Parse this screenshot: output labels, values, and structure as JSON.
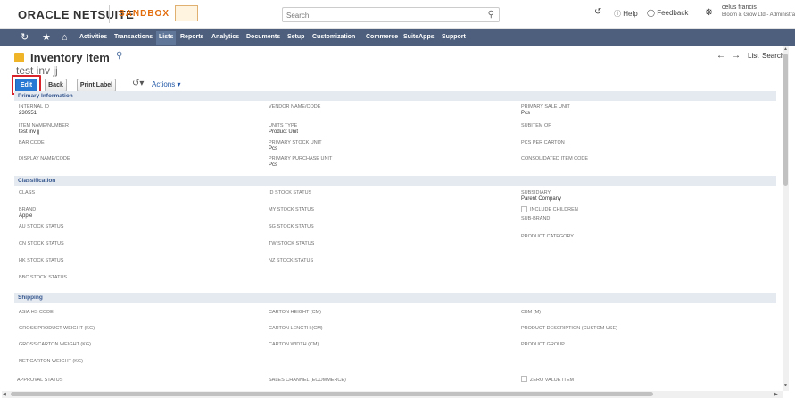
{
  "topbar": {
    "logo_main": "ORACLE NETSUITE",
    "environment": "SANDBOX",
    "search_placeholder": "Search",
    "help_label": "Help",
    "feedback_label": "Feedback",
    "user_name": "celus francis",
    "user_role": "Bloom & Grow Ltd - Administrator"
  },
  "navbar": {
    "items": [
      "Activities",
      "Transactions",
      "Lists",
      "Reports",
      "Analytics",
      "Documents",
      "Setup",
      "Customization",
      "Commerce",
      "SuiteApps",
      "Support"
    ],
    "active": "Lists"
  },
  "header": {
    "title": "Inventory Item",
    "record_name": "test inv jj",
    "list_link": "List",
    "search_link": "Search"
  },
  "buttons": {
    "edit": "Edit",
    "back": "Back",
    "print_label": "Print Label",
    "actions": "Actions"
  },
  "sections": {
    "primary": "Primary Information",
    "classification": "Classification",
    "shipping": "Shipping"
  },
  "primary_fields": {
    "internal_id_label": "INTERNAL ID",
    "internal_id_value": "230551",
    "item_name_label": "ITEM NAME/NUMBER",
    "item_name_value": "test inv jj",
    "bar_code_label": "BAR CODE",
    "display_name_label": "DISPLAY NAME/CODE",
    "vendor_name_label": "VENDOR NAME/CODE",
    "units_type_label": "UNITS TYPE",
    "units_type_value": "Product Unit",
    "primary_stock_unit_label": "PRIMARY STOCK UNIT",
    "primary_stock_unit_value": "Pcs",
    "primary_purchase_unit_label": "PRIMARY PURCHASE UNIT",
    "primary_purchase_unit_value": "Pcs",
    "primary_sale_unit_label": "PRIMARY SALE UNIT",
    "primary_sale_unit_value": "Pcs",
    "subitem_of_label": "SUBITEM OF",
    "pcs_per_carton_label": "PCS PER CARTON",
    "consolidated_item_code_label": "CONSOLIDATED ITEM CODE"
  },
  "classification_fields": {
    "class_label": "CLASS",
    "brand_label": "BRAND",
    "brand_value": "Apple",
    "au_stock_label": "AU STOCK STATUS",
    "cn_stock_label": "CN STOCK STATUS",
    "hk_stock_label": "HK STOCK STATUS",
    "bbc_stock_label": "BBC STOCK STATUS",
    "id_stock_label": "ID STOCK STATUS",
    "my_stock_label": "MY STOCK STATUS",
    "sg_stock_label": "SG STOCK STATUS",
    "tw_stock_label": "TW STOCK STATUS",
    "nz_stock_label": "NZ STOCK STATUS",
    "subsidiary_label": "SUBSIDIARY",
    "subsidiary_value": "Parent Company",
    "include_children_label": "INCLUDE CHILDREN",
    "sub_brand_label": "SUB-BRAND",
    "product_category_label": "PRODUCT CATEGORY"
  },
  "shipping_fields": {
    "asia_hs_code_label": "ASIA HS CODE",
    "gross_product_weight_label": "GROSS PRODUCT WEIGHT (KG)",
    "gross_carton_weight_label": "GROSS CARTON WEIGHT (KG)",
    "net_carton_weight_label": "NET CARTON WEIGHT (KG)",
    "approval_status_label": "APPROVAL STATUS",
    "carton_height_label": "CARTON HEIGHT (CM)",
    "carton_length_label": "CARTON LENGTH (CM)",
    "carton_width_label": "CARTON WIDTH (CM)",
    "sales_channel_label": "SALES CHANNEL (ECOMMERCE)",
    "cbm_label": "CBM (M)",
    "product_description_label": "PRODUCT DESCRIPTION (CUSTOM USE)",
    "product_group_label": "PRODUCT GROUP",
    "zero_value_item_label": "ZERO VALUE ITEM"
  },
  "colors": {
    "navbar": "#4d5f7c",
    "section_bar": "#e5eaf1",
    "edit_button": "#2779d3",
    "highlight": "#d8232a",
    "sandbox": "#e36c0a"
  },
  "icons": [
    "search-icon",
    "help-icon",
    "feedback-icon",
    "recent-icon",
    "star-icon",
    "home-icon",
    "back-arrow-icon",
    "forward-arrow-icon",
    "actions-icon",
    "record-icon"
  ]
}
